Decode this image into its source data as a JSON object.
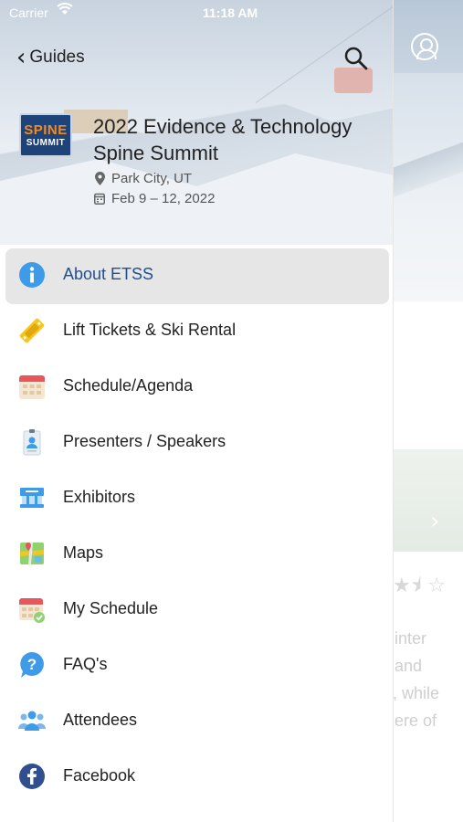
{
  "status_bar": {
    "carrier": "Carrier",
    "time": "11:18 AM"
  },
  "header": {
    "back_label": "Guides"
  },
  "event": {
    "logo_line1": "SPINE",
    "logo_line2": "SUMMIT",
    "title": "2022 Evidence & Technology Spine Summit",
    "location": "Park City, UT",
    "dates": "Feb 9 – 12, 2022"
  },
  "menu": {
    "items": [
      {
        "label": "About ETSS",
        "icon": "info-icon",
        "selected": true
      },
      {
        "label": "Lift Tickets & Ski Rental",
        "icon": "ticket-icon"
      },
      {
        "label": "Schedule/Agenda",
        "icon": "calendar-icon"
      },
      {
        "label": "Presenters / Speakers",
        "icon": "badge-icon"
      },
      {
        "label": "Exhibitors",
        "icon": "booth-icon"
      },
      {
        "label": "Maps",
        "icon": "map-icon"
      },
      {
        "label": "My Schedule",
        "icon": "calendar-check-icon"
      },
      {
        "label": "FAQ's",
        "icon": "question-icon"
      },
      {
        "label": "Attendees",
        "icon": "people-icon"
      },
      {
        "label": "Facebook",
        "icon": "facebook-icon"
      }
    ]
  },
  "background": {
    "text_lines": [
      "inter",
      "and",
      ", while",
      "ere of"
    ]
  },
  "colors": {
    "accent": "#1f4f8f",
    "info_blue": "#3d9be9"
  }
}
